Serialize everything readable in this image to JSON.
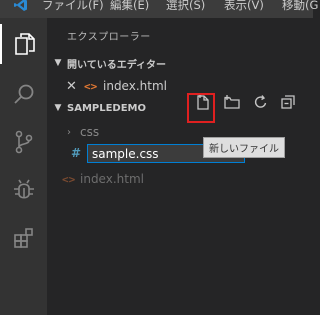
{
  "menubar": {
    "items": [
      "ファイル(F)",
      "編集(E)",
      "選択(S)",
      "表示(V)",
      "移動(G"
    ]
  },
  "colors": {
    "activity_bg": "#333333",
    "sidebar_bg": "#252526",
    "menubar_bg": "#3c3c3c",
    "highlight": "#e02020",
    "input_border": "#007fd4"
  },
  "activity_bar": {
    "items": [
      {
        "name": "explorer-icon",
        "active": true
      },
      {
        "name": "search-icon",
        "active": false
      },
      {
        "name": "source-control-icon",
        "active": false
      },
      {
        "name": "debug-icon",
        "active": false
      },
      {
        "name": "extensions-icon",
        "active": false
      }
    ]
  },
  "sidebar": {
    "title": "エクスプローラー",
    "open_editors": {
      "header": "開いているエディター",
      "files": [
        {
          "close": "✕",
          "icon": "<>",
          "name": "index.html"
        }
      ]
    },
    "workspace": {
      "header": "SAMPLEDEMO",
      "toolbar": {
        "new_file_icon": "new-file-icon",
        "new_folder_icon": "new-folder-icon",
        "refresh_icon": "refresh-icon",
        "collapse_icon": "collapse-all-icon"
      },
      "folder": {
        "name": "css"
      },
      "new_file_input": {
        "icon": "#",
        "value": "sample.css"
      },
      "files": [
        {
          "icon": "<>",
          "name": "index.html"
        }
      ]
    }
  },
  "tooltip": {
    "text": "新しいファイル"
  }
}
